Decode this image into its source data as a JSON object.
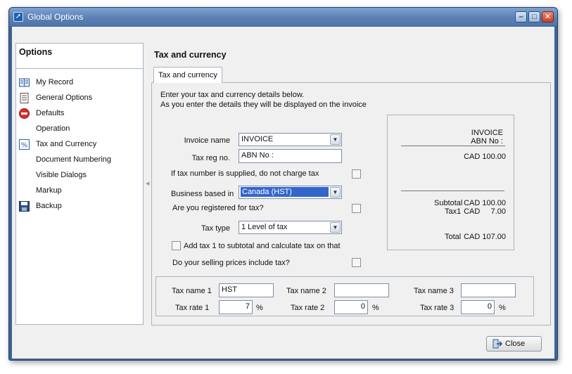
{
  "window": {
    "title": "Global Options"
  },
  "sidebar": {
    "title": "Options",
    "items": [
      {
        "label": "My Record",
        "icon": "book-icon"
      },
      {
        "label": "General Options",
        "icon": "document-icon"
      },
      {
        "label": "Defaults",
        "icon": "no-entry-icon"
      },
      {
        "label": "Operation",
        "icon": ""
      },
      {
        "label": "Tax and Currency",
        "icon": "percent-icon"
      },
      {
        "label": "Document Numbering",
        "icon": ""
      },
      {
        "label": "Visible Dialogs",
        "icon": ""
      },
      {
        "label": "Markup",
        "icon": ""
      },
      {
        "label": "Backup",
        "icon": "floppy-disk-icon"
      }
    ]
  },
  "main": {
    "section_title": "Tax and currency",
    "tab_label": "Tax and currency",
    "intro_line1": "Enter your tax and currency details below.",
    "intro_line2": "As you enter the details they will be displayed on the invoice",
    "form": {
      "invoice_name_label": "Invoice name",
      "invoice_name_value": "INVOICE",
      "tax_reg_label": "Tax reg no.",
      "tax_reg_value": "ABN No :",
      "no_tax_if_number_label": "If tax number is supplied, do not charge tax",
      "business_based_label": "Business based in",
      "business_based_value": "Canada (HST)",
      "registered_label": "Are you registered for tax?",
      "tax_type_label": "Tax type",
      "tax_type_value": "1 Level of tax",
      "add_tax1_label": "Add tax 1 to subtotal and calculate tax on that",
      "prices_include_tax_label": "Do your selling prices include tax?"
    },
    "preview": {
      "invoice_title": "INVOICE",
      "abn": "ABN No :",
      "line_amount": "CAD  100.00",
      "subtotal_label": "Subtotal",
      "subtotal_value": "CAD  100.00",
      "tax1_label": "Tax1",
      "tax1_value": "CAD     7.00",
      "total_label": "Total",
      "total_value": "CAD  107.00"
    },
    "taxes": {
      "name1_label": "Tax name 1",
      "name1_value": "HST",
      "name2_label": "Tax name 2",
      "name2_value": "",
      "name3_label": "Tax name 3",
      "name3_value": "",
      "rate1_label": "Tax rate 1",
      "rate1_value": "7",
      "rate2_label": "Tax rate 2",
      "rate2_value": "0",
      "rate3_label": "Tax rate 3",
      "rate3_value": "0",
      "percent": "%"
    }
  },
  "footer": {
    "close_label": "Close"
  },
  "colors": {
    "titlebar": "#5a80b5",
    "selection": "#3366cc",
    "close_button": "#c6402b"
  }
}
